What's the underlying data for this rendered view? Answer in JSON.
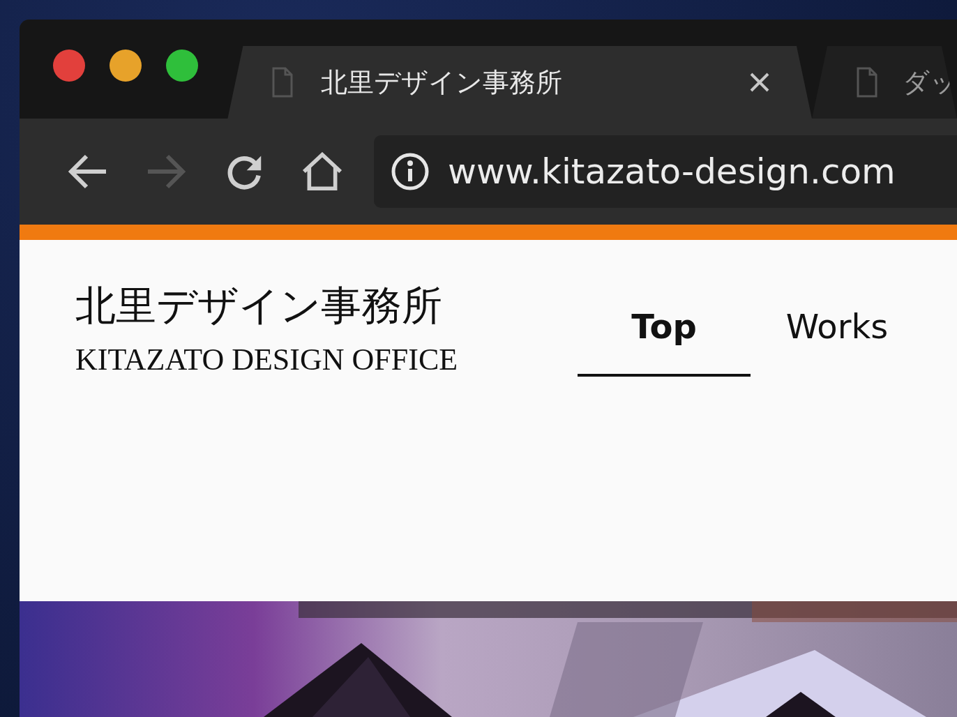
{
  "tabs": [
    {
      "title": "北里デザイン事務所",
      "selected": true,
      "closable": true
    },
    {
      "title": "ダッ",
      "selected": false,
      "closable": false
    }
  ],
  "toolbar": {
    "buttons": [
      {
        "kind": "back",
        "disabled": false
      },
      {
        "kind": "forward",
        "disabled": true
      },
      {
        "kind": "reload",
        "disabled": false
      },
      {
        "kind": "home",
        "disabled": false
      }
    ],
    "address": "www.kitazato-design.com"
  },
  "site": {
    "title": "北里デザイン事務所",
    "subtitle": "KITAZATO DESIGN OFFICE",
    "nav": [
      {
        "label": "Top",
        "selected": true
      },
      {
        "label": "Works",
        "selected": false
      }
    ]
  }
}
